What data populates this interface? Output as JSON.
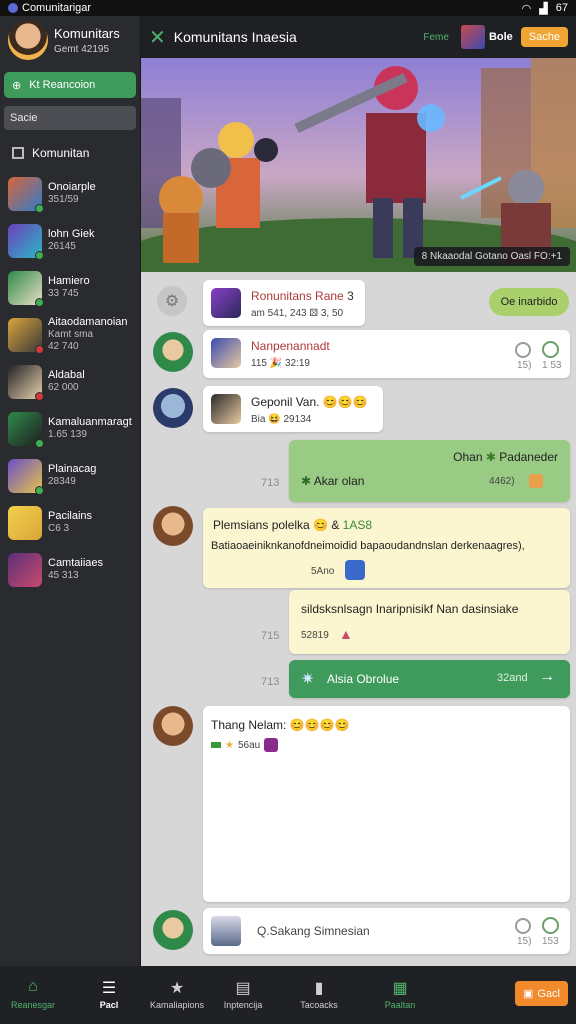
{
  "status_bar": {
    "app": "Comunitarigar",
    "right": "67"
  },
  "profile": {
    "name": "Komunitars",
    "sub": "Gemt 42195"
  },
  "sidebar": {
    "green_button": "Kt Reancoion",
    "search_placeholder": "Sacie",
    "header": "Komunitan",
    "items": [
      {
        "title": "Onoiarple",
        "meta": "351/59",
        "c1": "#d9653a",
        "c2": "#2f7bc9",
        "dot": "#3fae52"
      },
      {
        "title": "lohn Giek",
        "meta": "26145",
        "c1": "#6d3fb8",
        "c2": "#2ab7c7",
        "dot": "#3fae52"
      },
      {
        "title": "Hamiero",
        "meta": "33 745",
        "c1": "#2f8a4a",
        "c2": "#e8e0c5",
        "dot": "#3fae52"
      },
      {
        "title": "Aitaodamanoian",
        "meta": "Kamt sma",
        "meta2": "42 740",
        "c1": "#d9a53a",
        "c2": "#3a3a3a",
        "dot": "#d23a3a"
      },
      {
        "title": "Aldabal",
        "meta": "62 000",
        "c1": "#222222",
        "c2": "#e8d0b0",
        "dot": "#d23a3a"
      },
      {
        "title": "Kamaluanmaragt",
        "meta": "1.65 139",
        "c1": "#2f8a4a",
        "c2": "#1f1f1f",
        "dot": "#3fae52"
      },
      {
        "title": "Plainacag",
        "meta": "28349",
        "c1": "#6a4fc7",
        "c2": "#e8c34a",
        "dot": "#3fae52"
      },
      {
        "title": "Pacilains",
        "meta": "C6 3",
        "c1": "#f2d04a",
        "c2": "#d9a53a",
        "dot": ""
      },
      {
        "title": "Camtaiiaes",
        "meta": "45 313",
        "c1": "#5a2f7a",
        "c2": "#c94a6a",
        "dot": ""
      }
    ]
  },
  "topbar": {
    "title": "Komunitans Inaesia",
    "link": "Feme",
    "name": "Bole",
    "button": "Sache"
  },
  "banner": {
    "caption": "8 Nkaaodal Gotano  Oasl FO:+1"
  },
  "messages": {
    "m1": {
      "title": "Ronunitans Rane",
      "title_suffix": "3",
      "meta": "am  541, 243  ⚄ 3, 50",
      "reaction_button": "Oe inarbido"
    },
    "m2": {
      "title": "Nanpenannadt",
      "meta": "115 🎉 32:19",
      "ts1": "15)",
      "ts2": "1 53"
    },
    "m3": {
      "title": "Geponil Van.",
      "emojis": "😊😊😊",
      "meta": "Bia 😆 29134"
    },
    "m4": {
      "title": "Ohan",
      "title2": "Padaneder",
      "body": "Akar olan",
      "ts": "4462)",
      "time": "713"
    },
    "m5": {
      "title": "Plemsians polelka 😊 &",
      "tag": "1AS8",
      "body": "Batiaoaeiniknkanofdneimoidid bapaoudandnslan derkenaagres),",
      "name": "5Ano"
    },
    "m6": {
      "body": "sildsksnlsagn Inaripnisikf Nan dasinsiake",
      "meta": "52819",
      "time": "715"
    },
    "m7": {
      "body": "Alsia Obrolue",
      "time": "32and",
      "ts": "713"
    },
    "m8": {
      "title": "Thang Nelam:",
      "emojis": "😊😊😊😊",
      "meta": "56au"
    },
    "m9": {
      "body": "Q.Sakang Simnesian",
      "ts1": "15)",
      "ts2": "153"
    }
  },
  "bottom_nav": {
    "items": [
      "Reanesgar",
      "Pacl",
      "Kamaliapions",
      "Inptencija",
      "Tacoacks",
      "Paaltan"
    ],
    "action": "Gacl"
  },
  "colors": {
    "accent": "#3f9b5c",
    "orange": "#f0a433",
    "dark": "#2a2b2f"
  }
}
